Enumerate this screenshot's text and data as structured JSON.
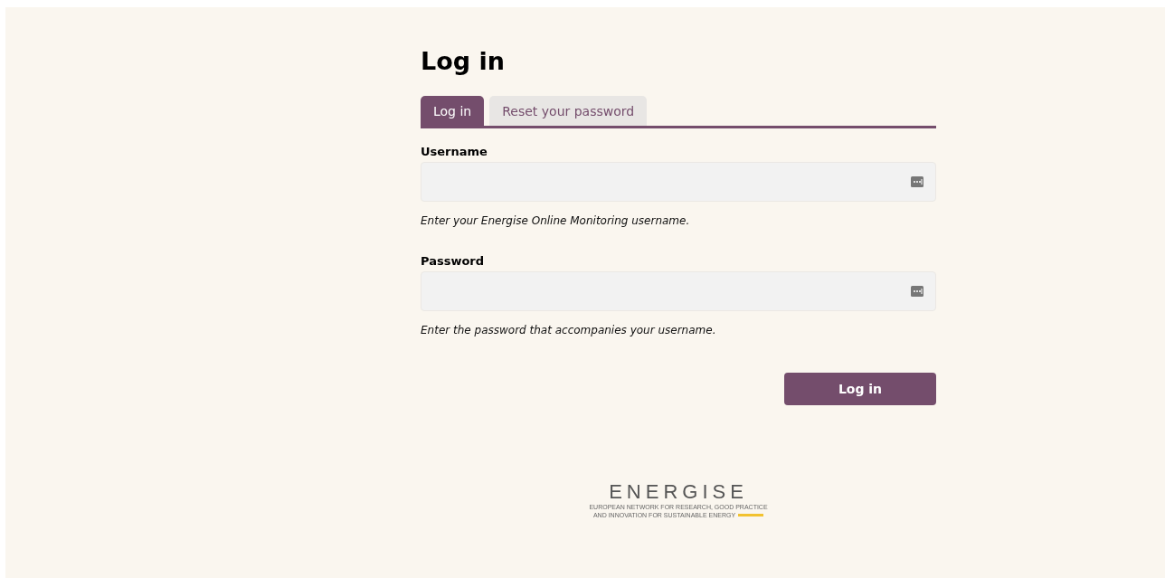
{
  "title": "Log in",
  "tabs": [
    {
      "label": "Log in",
      "selected": true
    },
    {
      "label": "Reset your password",
      "selected": false
    }
  ],
  "fields": [
    {
      "label": "Username",
      "description": "Enter your Energise Online Monitoring username."
    },
    {
      "label": "Password",
      "description": "Enter the password that accompanies your username."
    }
  ],
  "submit": "Log in",
  "logo": {
    "wordmark": "ENERGISE",
    "tagline_lines": [
      "EUROPEAN NETWORK FOR RESEARCH, GOOD PRACTICE",
      "AND INNOVATION FOR SUSTAINABLE ENERGY"
    ]
  }
}
